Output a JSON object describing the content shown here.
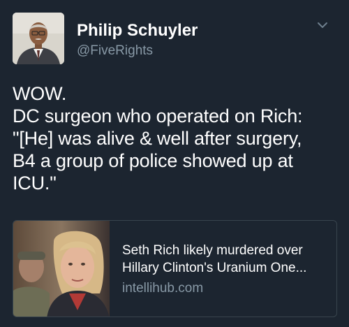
{
  "author": {
    "display_name": "Philip Schuyler",
    "handle": "@FiveRights",
    "avatar_icon": "portrait-photo"
  },
  "tweet": {
    "lines": [
      "WOW.",
      "DC surgeon who operated on Rich:",
      "\"[He] was alive & well after surgery,",
      "B4 a group of police showed up at",
      "ICU.\""
    ]
  },
  "menu": {
    "icon": "chevron-down-icon"
  },
  "link_card": {
    "title_lines": [
      "Seth Rich likely murdered over",
      "Hillary Clinton's Uranium One..."
    ],
    "domain": "intellihub.com",
    "image_icon": "news-photo"
  },
  "colors": {
    "background": "#1c2530",
    "text_primary": "#ffffff",
    "text_secondary": "#8899a6",
    "card_border": "#38444d"
  }
}
